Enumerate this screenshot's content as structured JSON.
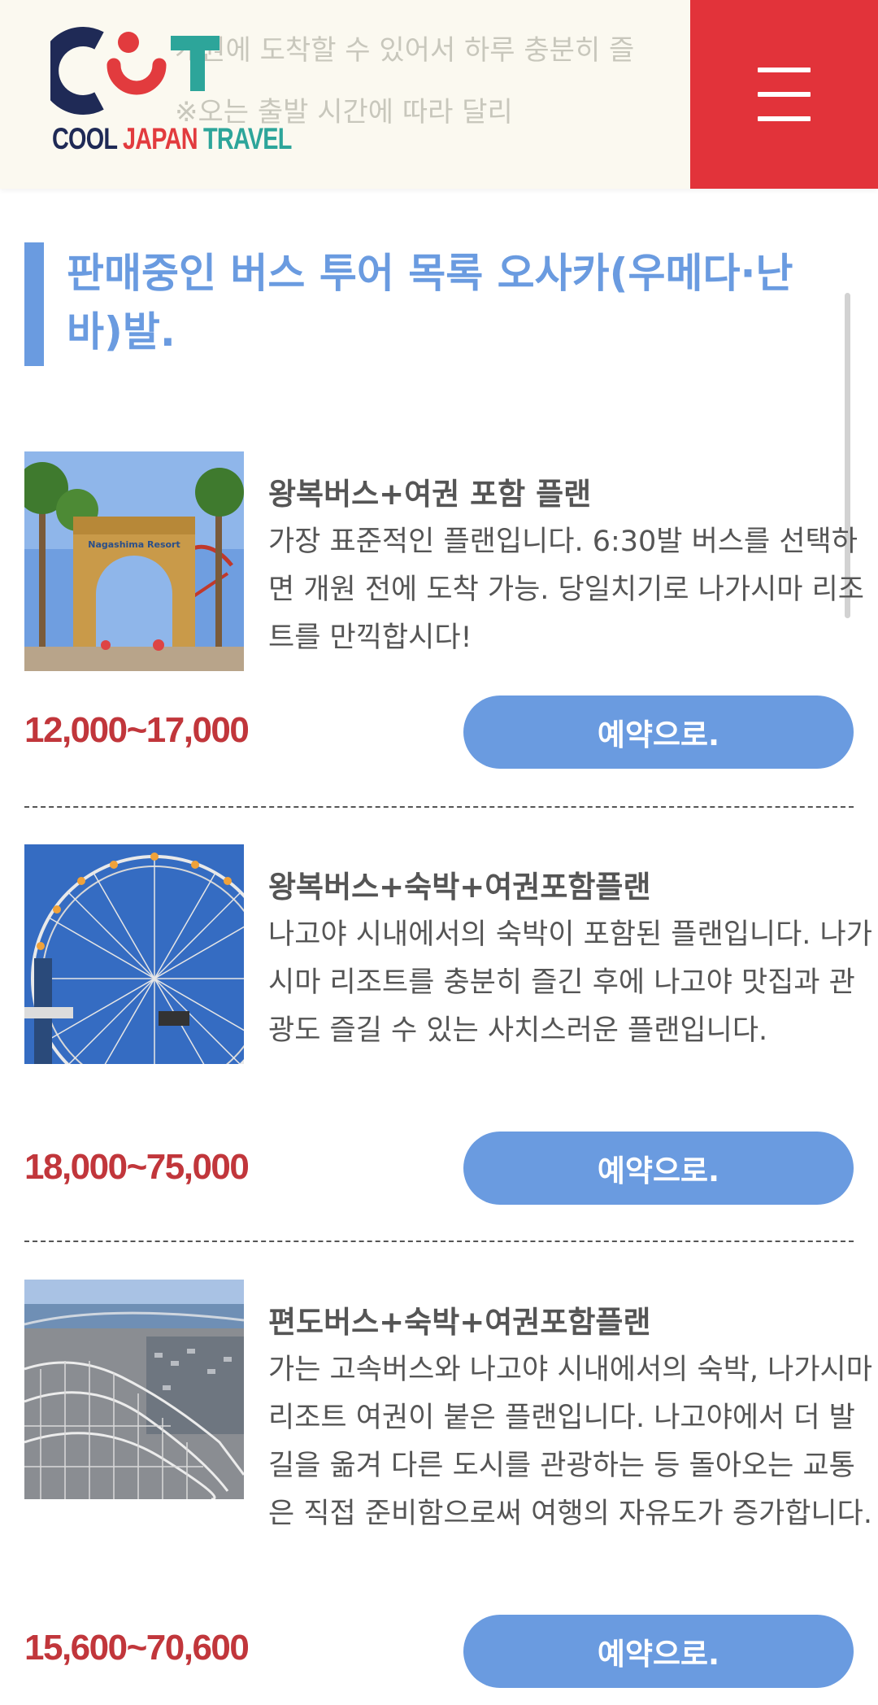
{
  "header": {
    "bg_text_line1": "개원에 도착할 수 있어서 하루 충분히 즐",
    "bg_text_line2": "※오는 출발 시간에 따라 달리",
    "logo": {
      "word1": "COOL",
      "word2": "JAPAN",
      "word3": "TRAVEL",
      "colors": {
        "navy": "#1f2a56",
        "red": "#e23b3e",
        "teal": "#2da59a"
      }
    },
    "menu_icon": "hamburger-icon",
    "menu_color": "#e2333a"
  },
  "section": {
    "title": "판매중인 버스 투어 목록 오사카(우메다·난바)발.",
    "accent": "#6a9be0"
  },
  "plans": [
    {
      "image": "nagashima-resort-gate",
      "title": "왕복버스+여권 포함 플랜",
      "description": "가장 표준적인 플랜입니다. 6:30발 버스를 선택하면 개원 전에 도착 가능. 당일치기로 나가시마 리조트를 만끽합시다!",
      "price": "12,000~17,000",
      "button_label": "예약으로."
    },
    {
      "image": "ferris-wheel",
      "title": "왕복버스+숙박+여권포함플랜",
      "description": "나고야 시내에서의 숙박이 포함된 플랜입니다. 나가시마 리조트를 충분히 즐긴 후에 나고야 맛집과 관광도 즐길 수 있는 사치스러운 플랜입니다.",
      "price": "18,000~75,000",
      "button_label": "예약으로."
    },
    {
      "image": "wooden-roller-coaster",
      "title": "편도버스+숙박+여권포함플랜",
      "description": "가는 고속버스와 나고야 시내에서의 숙박, 나가시마 리조트 여권이 붙은 플랜입니다. 나고야에서 더 발길을 옮겨 다른 도시를 관광하는 등 돌아오는 교통은 직접 준비함으로써 여행의 자유도가 증가합니다.",
      "price": "15,600~70,600",
      "button_label": "예약으로."
    }
  ],
  "colors": {
    "price": "#c1363b",
    "button": "#6a9be0",
    "text": "#555555"
  }
}
